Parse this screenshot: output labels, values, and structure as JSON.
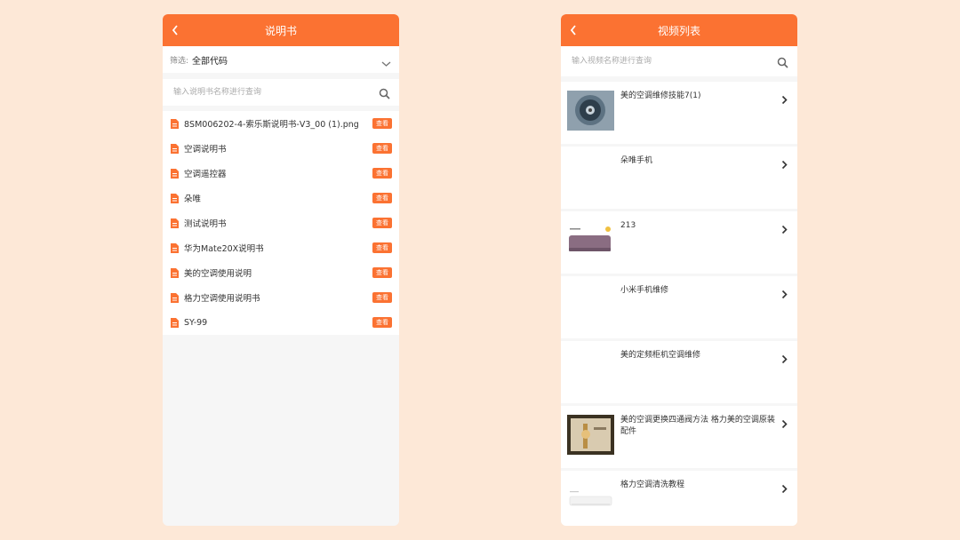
{
  "manual_screen": {
    "title": "说明书",
    "filter": {
      "label": "筛选:",
      "value": "全部代码"
    },
    "search": {
      "placeholder": "输入说明书名称进行查询"
    },
    "view_label": "查看",
    "items": [
      {
        "name": "8SM006202-4-索乐斯说明书-V3_00 (1).png"
      },
      {
        "name": "空调说明书"
      },
      {
        "name": "空调遥控器"
      },
      {
        "name": "朵唯"
      },
      {
        "name": "测试说明书"
      },
      {
        "name": "华为Mate20X说明书"
      },
      {
        "name": "美的空调使用说明"
      },
      {
        "name": "格力空调使用说明书"
      },
      {
        "name": "SY-99"
      }
    ]
  },
  "video_screen": {
    "title": "视频列表",
    "search": {
      "placeholder": "输入视频名称进行查询"
    },
    "items": [
      {
        "title": "美的空调维修技能7(1)",
        "thumb": "fan-wheel"
      },
      {
        "title": "朵唯手机",
        "thumb": "none"
      },
      {
        "title": "213",
        "thumb": "air-conditioner-purple"
      },
      {
        "title": "小米手机维修",
        "thumb": "none"
      },
      {
        "title": "美的定频柜机空调维修",
        "thumb": "none"
      },
      {
        "title": "美的空调更换四通阀方法 格力美的空调原装配件",
        "thumb": "valve-repair"
      },
      {
        "title": "格力空调清洗教程",
        "thumb": "air-conditioner-white"
      }
    ]
  },
  "colors": {
    "accent": "#fb7232",
    "page_bg": "#fde8d7",
    "panel_bg": "#f6f6f6"
  }
}
